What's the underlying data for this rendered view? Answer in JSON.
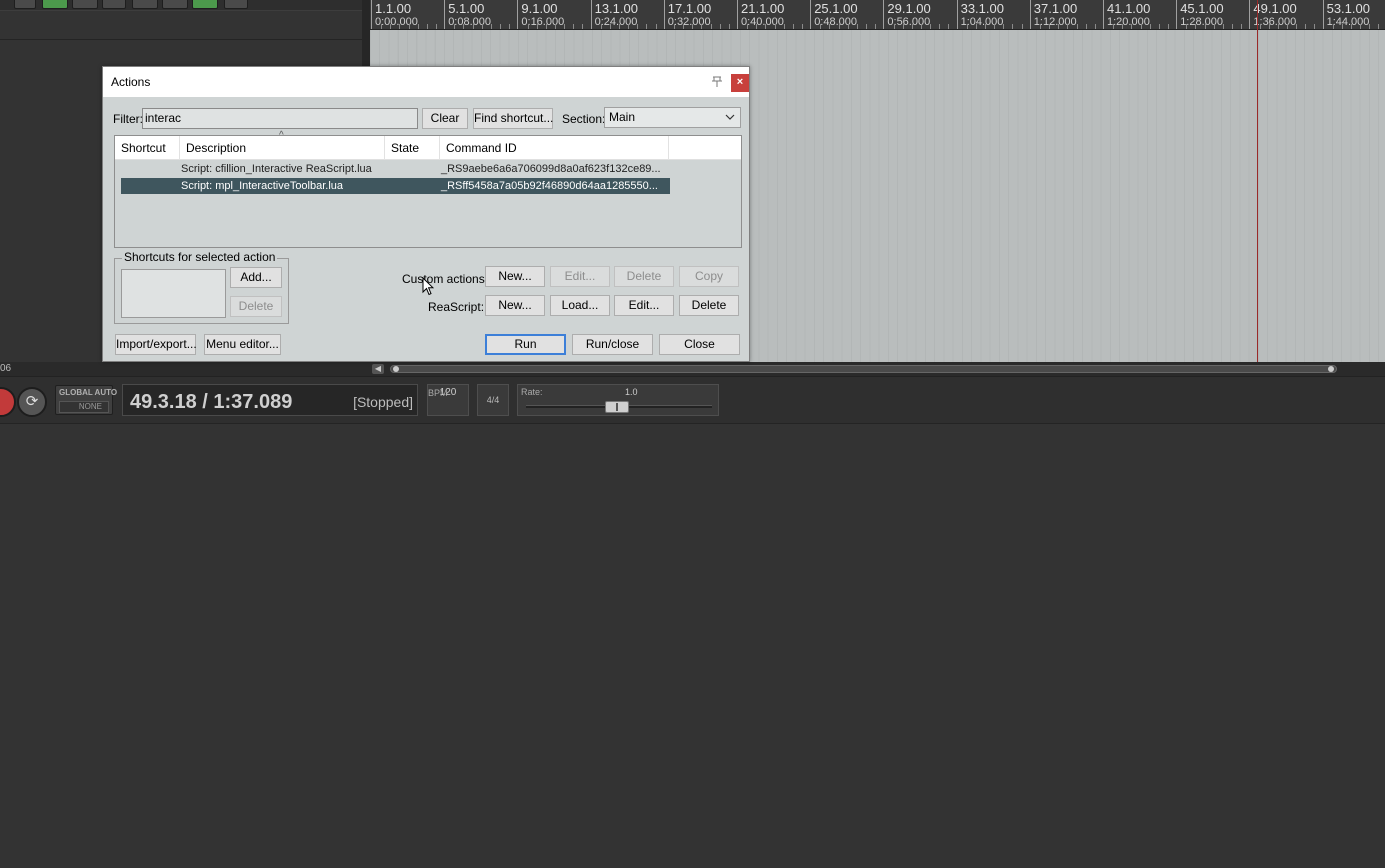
{
  "ruler": {
    "ticks": [
      {
        "bar": "1.1.00",
        "time": "0:00.000"
      },
      {
        "bar": "5.1.00",
        "time": "0:08.000"
      },
      {
        "bar": "9.1.00",
        "time": "0:16.000"
      },
      {
        "bar": "13.1.00",
        "time": "0:24.000"
      },
      {
        "bar": "17.1.00",
        "time": "0:32.000"
      },
      {
        "bar": "21.1.00",
        "time": "0:40.000"
      },
      {
        "bar": "25.1.00",
        "time": "0:48.000"
      },
      {
        "bar": "29.1.00",
        "time": "0:56.000"
      },
      {
        "bar": "33.1.00",
        "time": "1:04.000"
      },
      {
        "bar": "37.1.00",
        "time": "1:12.000"
      },
      {
        "bar": "41.1.00",
        "time": "1:20.000"
      },
      {
        "bar": "45.1.00",
        "time": "1:28.000"
      },
      {
        "bar": "49.1.00",
        "time": "1:36.000"
      },
      {
        "bar": "53.1.00",
        "time": "1:44.000"
      }
    ]
  },
  "scroll": {
    "left_text": "06"
  },
  "transport": {
    "global_auto_label": "GLOBAL AUTO",
    "global_auto_value": "NONE",
    "position": "49.3.18 / 1:37.089",
    "state": "[Stopped]",
    "bpm_label": "BPM",
    "bpm_value": "120",
    "time_signature": "4/4",
    "rate_label": "Rate:",
    "rate_value": "1.0"
  },
  "dialog": {
    "title": "Actions",
    "close_glyph": "×",
    "filter_label": "Filter:",
    "filter_value": "interac",
    "clear_label": "Clear",
    "find_shortcut_label": "Find shortcut...",
    "section_label": "Section:",
    "section_value": "Main",
    "columns": [
      "Shortcut",
      "Description",
      "State",
      "Command ID"
    ],
    "rows": [
      {
        "shortcut": "",
        "description": "Script: cfillion_Interactive ReaScript.lua",
        "state": "",
        "command_id": "_RS9aebe6a6a706099d8a0af623f132ce89...",
        "selected": false
      },
      {
        "shortcut": "",
        "description": "Script: mpl_InteractiveToolbar.lua",
        "state": "",
        "command_id": "_RSff5458a7a05b92f46890d64aa1285550...",
        "selected": true
      }
    ],
    "shortcuts_group_label": "Shortcuts for selected action",
    "shortcuts_add_label": "Add...",
    "shortcuts_delete_label": "Delete",
    "custom_actions_label": "Custom actions:",
    "custom_actions_buttons": {
      "new": "New...",
      "edit": "Edit...",
      "delete": "Delete",
      "copy": "Copy"
    },
    "reascript_label": "ReaScript:",
    "reascript_buttons": {
      "new": "New...",
      "load": "Load...",
      "edit": "Edit...",
      "delete": "Delete"
    },
    "import_export_label": "Import/export...",
    "menu_editor_label": "Menu editor...",
    "run_label": "Run",
    "run_close_label": "Run/close",
    "close_label": "Close"
  },
  "icons": {
    "pin": "pin-icon",
    "dropdown": "chevron-down-icon",
    "record": "record-icon",
    "repeat": "repeat-icon",
    "pointer": "mouse-pointer-icon"
  },
  "colors": {
    "selection": "#3f565e",
    "default_button_border": "#3c7fd8",
    "dialog_close": "#c8403c",
    "edit_cursor": "#9a2a2a"
  }
}
